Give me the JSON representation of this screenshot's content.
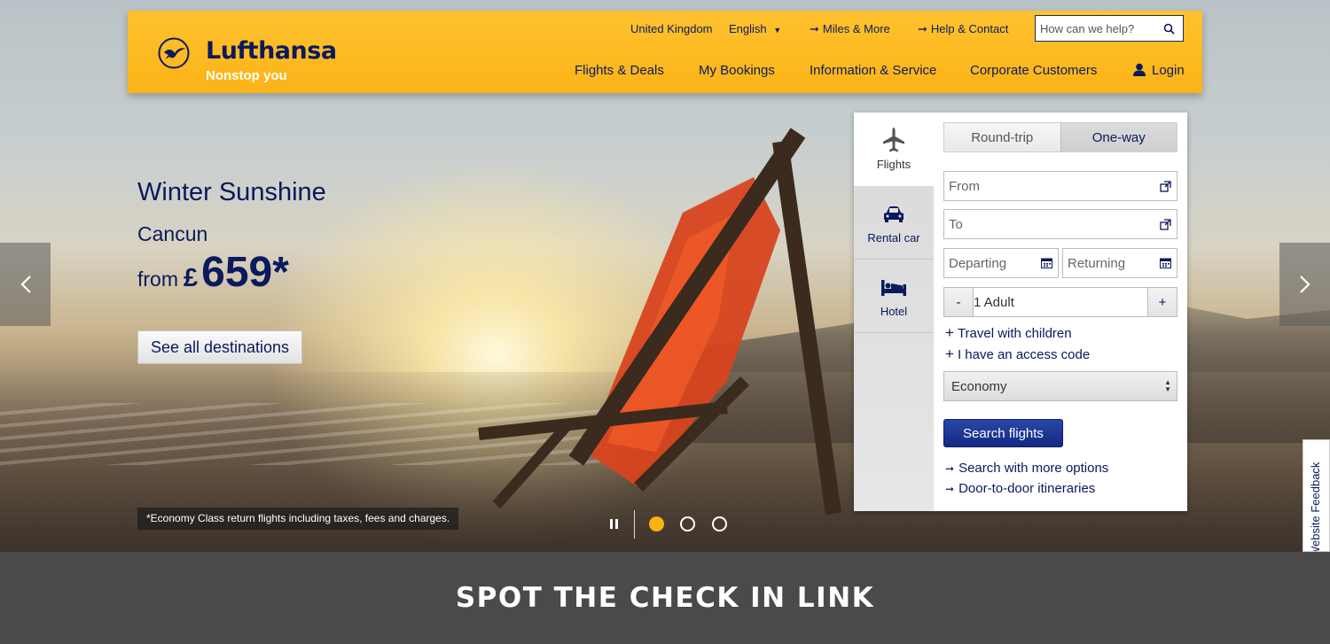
{
  "header": {
    "brand": "Lufthansa",
    "tagline": "Nonstop you",
    "country": "United Kingdom",
    "language": "English",
    "miles": "Miles & More",
    "help": "Help & Contact",
    "search_placeholder": "How can we help?",
    "nav": [
      "Flights & Deals",
      "My Bookings",
      "Information & Service",
      "Corporate Customers"
    ],
    "login": "Login"
  },
  "hero": {
    "title": "Winter Sunshine",
    "city": "Cancun",
    "from": "from",
    "currency": "£",
    "price": "659*",
    "cta": "See all destinations",
    "disclaimer": "*Economy Class return flights including taxes, fees and charges.",
    "slides": {
      "count": 3,
      "active": 1
    }
  },
  "booking": {
    "tabs": [
      "Flights",
      "Rental car",
      "Hotel"
    ],
    "active_tab": "Flights",
    "trip_types": [
      "Round-trip",
      "One-way"
    ],
    "selected_trip": "One-way",
    "from_placeholder": "From",
    "to_placeholder": "To",
    "departing_placeholder": "Departing",
    "returning_placeholder": "Returning",
    "minus": "-",
    "plus": "+",
    "passengers": "1 Adult",
    "travel_children": "Travel with children",
    "access_code": "I have an access code",
    "cabin_class": "Economy",
    "search_button": "Search flights",
    "more_options": "Search with more options",
    "door_to_door": "Door-to-door itineraries"
  },
  "feedback": "Website Feedback",
  "banner": "SPOT THE CHECK IN LINK",
  "colors": {
    "brand_yellow": "#fbb317",
    "brand_navy": "#0a1a5c",
    "active_dot": "#f5b317"
  }
}
